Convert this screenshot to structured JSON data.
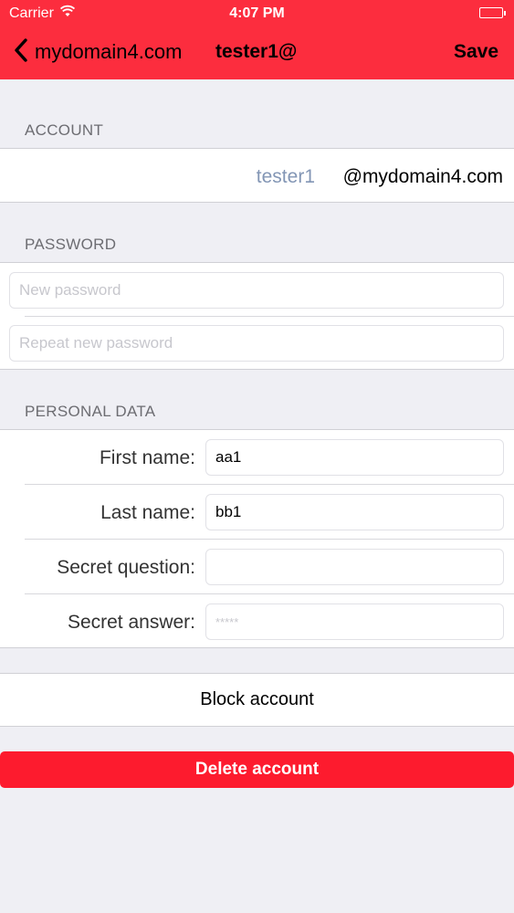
{
  "status_bar": {
    "carrier": "Carrier",
    "time": "4:07 PM"
  },
  "nav": {
    "back_label": "mydomain4.com",
    "title": "tester1@",
    "save_label": "Save"
  },
  "account": {
    "header": "ACCOUNT",
    "username": "tester1",
    "domain": "@mydomain4.com"
  },
  "password": {
    "header": "PASSWORD",
    "new_placeholder": "New password",
    "repeat_placeholder": "Repeat new password"
  },
  "personal": {
    "header": "PERSONAL DATA",
    "first_name_label": "First name:",
    "first_name_value": "aa1",
    "last_name_label": "Last name:",
    "last_name_value": "bb1",
    "secret_question_label": "Secret question:",
    "secret_question_value": "",
    "secret_answer_label": "Secret answer:",
    "secret_answer_value": "*****"
  },
  "actions": {
    "block_label": "Block account",
    "delete_label": "Delete account"
  },
  "colors": {
    "accent": "#fc2d3e",
    "delete": "#fd1b2e",
    "username_text": "#8396b5",
    "background": "#efeff4"
  },
  "icons": {
    "back": "chevron-left-icon",
    "wifi": "wifi-icon",
    "battery": "battery-icon"
  }
}
